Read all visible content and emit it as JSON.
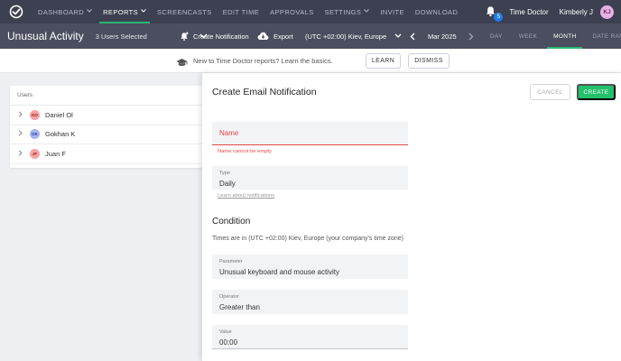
{
  "nav": {
    "items": [
      {
        "label": "DASHBOARD",
        "caret": true,
        "active": false
      },
      {
        "label": "REPORTS",
        "caret": true,
        "active": true
      },
      {
        "label": "SCREENCASTS",
        "caret": false,
        "active": false
      },
      {
        "label": "EDIT TIME",
        "caret": false,
        "active": false
      },
      {
        "label": "APPROVALS",
        "caret": false,
        "active": false
      },
      {
        "label": "SETTINGS",
        "caret": true,
        "active": false
      },
      {
        "label": "INVITE",
        "caret": false,
        "active": false
      },
      {
        "label": "DOWNLOAD",
        "caret": false,
        "active": false
      }
    ],
    "notification_count": "5",
    "company": "Time Doctor",
    "user_name": "Kimberly J",
    "user_initials": "KJ"
  },
  "subheader": {
    "title": "Unusual Activity",
    "users_selected": "3 Users Selected",
    "create_notification": "Create Notification",
    "export": "Export",
    "timezone": "(UTC +02:00) Kiev, Europe",
    "period": "Mar 2025",
    "ranges": [
      {
        "label": "DAY",
        "active": false
      },
      {
        "label": "WEEK",
        "active": false
      },
      {
        "label": "MONTH",
        "active": true
      },
      {
        "label": "DATE RANGE",
        "active": false
      }
    ]
  },
  "banner": {
    "text": "New to Time Doctor reports? Learn the basics.",
    "learn": "LEARN",
    "dismiss": "DISMISS"
  },
  "users_panel": {
    "header": "Users",
    "rows": [
      {
        "initials": "DO",
        "name": "Daniel Ol",
        "bg": "#f5a3a3",
        "fg": "#a32020"
      },
      {
        "initials": "GK",
        "name": "Gokhan K",
        "bg": "#a8b3f0",
        "fg": "#2b3aa0"
      },
      {
        "initials": "JF",
        "name": "Juan F",
        "bg": "#f5a3a3",
        "fg": "#a32020"
      }
    ]
  },
  "drawer": {
    "title": "Create Email Notification",
    "cancel": "CANCEL",
    "create": "CREATE",
    "name_label": "Name",
    "name_error": "Name cannot be empty",
    "type_label": "Type",
    "type_value": "Daily",
    "learn_link": "Learn about notifications",
    "condition_title": "Condition",
    "tz_note": "Times are in (UTC +02:00) Kiev, Europe (your company's time zone)",
    "parameter_label": "Parameter",
    "parameter_value": "Unusual keyboard and mouse activity",
    "operator_label": "Operator",
    "operator_value": "Greater than",
    "value_label": "Value",
    "value_value": "00:00"
  },
  "colors": {
    "nav_bg": "#3c4050",
    "subheader_bg": "#4a4e5e",
    "accent_green": "#2bb673",
    "create_green": "#22c16b",
    "error_red": "#e64848",
    "badge_blue": "#1f7ef0"
  }
}
